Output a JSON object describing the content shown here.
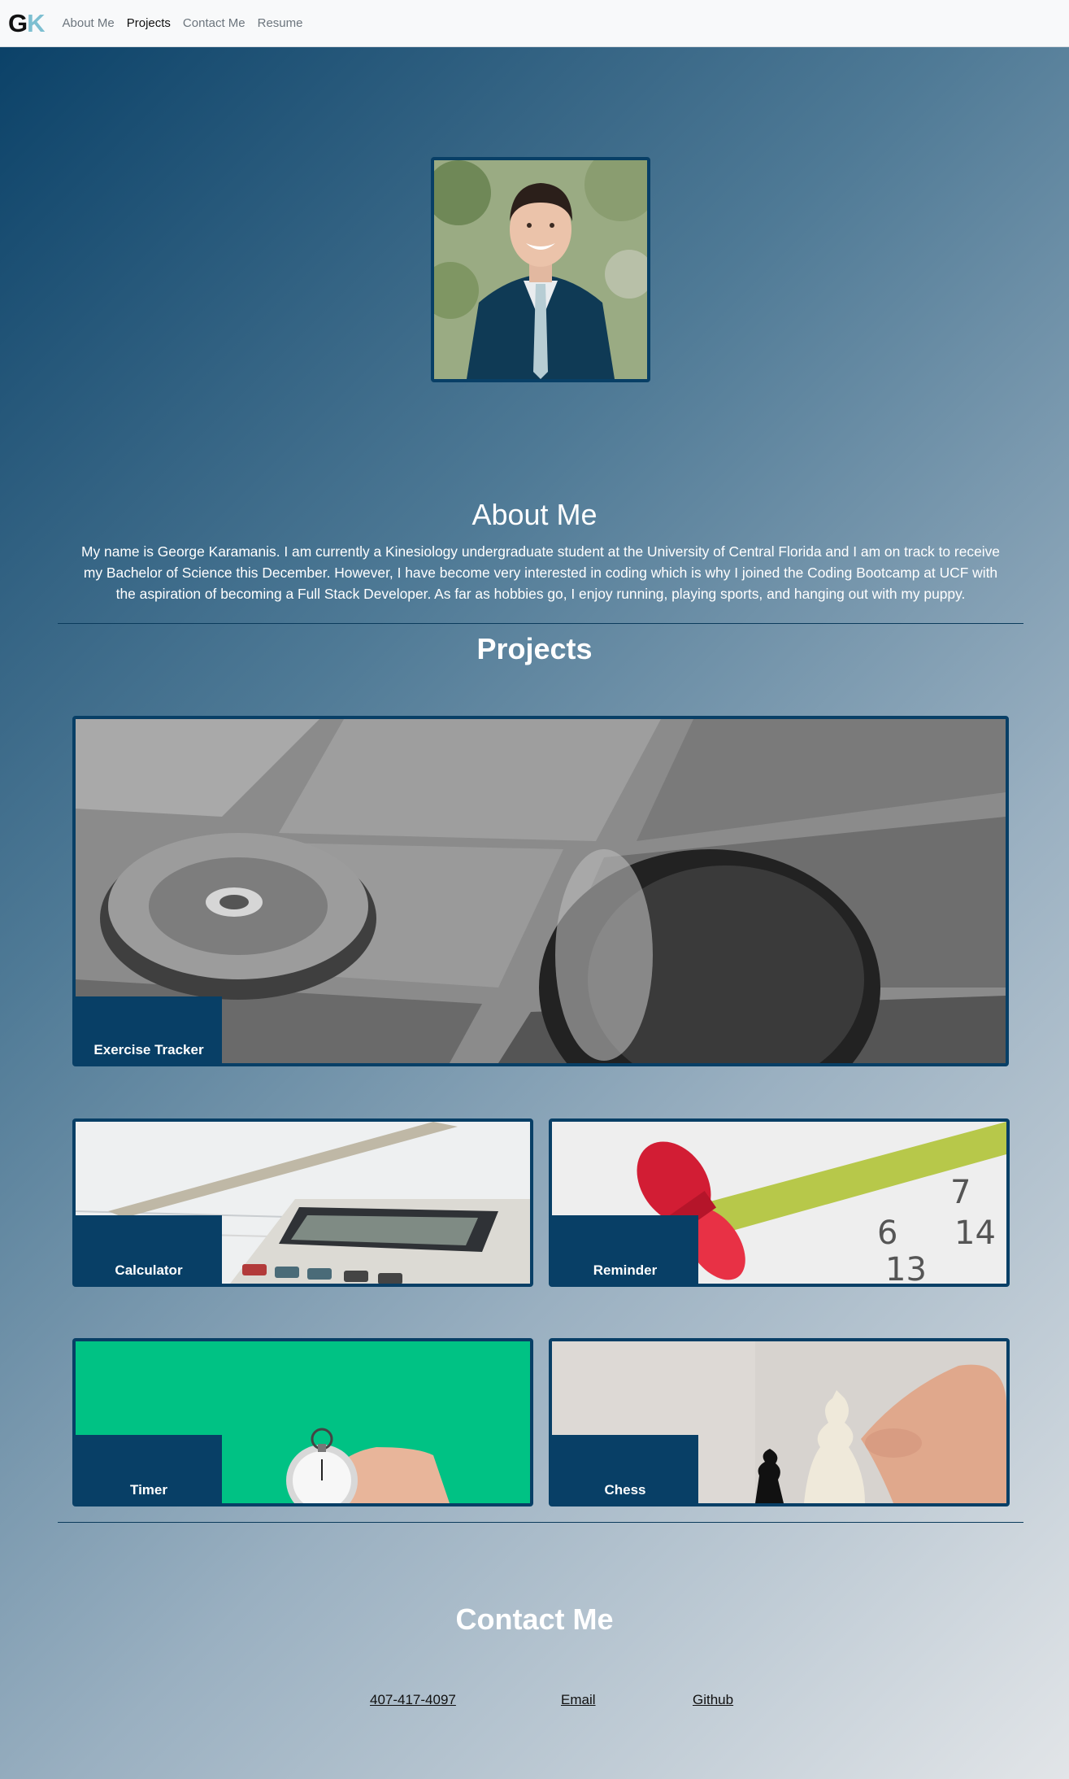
{
  "navbar": {
    "logo_g": "G",
    "logo_k": "K",
    "links": [
      {
        "label": "About Me",
        "active": false
      },
      {
        "label": "Projects",
        "active": true
      },
      {
        "label": "Contact Me",
        "active": false
      },
      {
        "label": "Resume",
        "active": false
      }
    ]
  },
  "about": {
    "title": "About Me",
    "text": "My name is George Karamanis. I am currently a Kinesiology undergraduate student at the University of Central Florida and I am on track to receive my Bachelor of Science this December. However, I have become very interested in coding which is why I joined the Coding Bootcamp at UCF with the aspiration of becoming a Full Stack Developer. As far as hobbies go, I enjoy running, playing sports, and hanging out with my puppy."
  },
  "projects": {
    "title": "Projects",
    "items": [
      {
        "label": "Exercise Tracker",
        "image": "dumbbell-plates-photo"
      },
      {
        "label": "Calculator",
        "image": "calculator-photo"
      },
      {
        "label": "Reminder",
        "image": "calendar-pin-photo"
      },
      {
        "label": "Timer",
        "image": "stopwatch-photo"
      },
      {
        "label": "Chess",
        "image": "chess-pieces-photo"
      }
    ]
  },
  "contact": {
    "title": "Contact Me",
    "phone": "407-417-4097",
    "email": "Email",
    "github": "Github"
  },
  "colors": {
    "accent": "#083f66",
    "navbar_bg": "#f8f9fa",
    "logo_k": "#7dbfd1",
    "timer_bg": "#00c284"
  }
}
